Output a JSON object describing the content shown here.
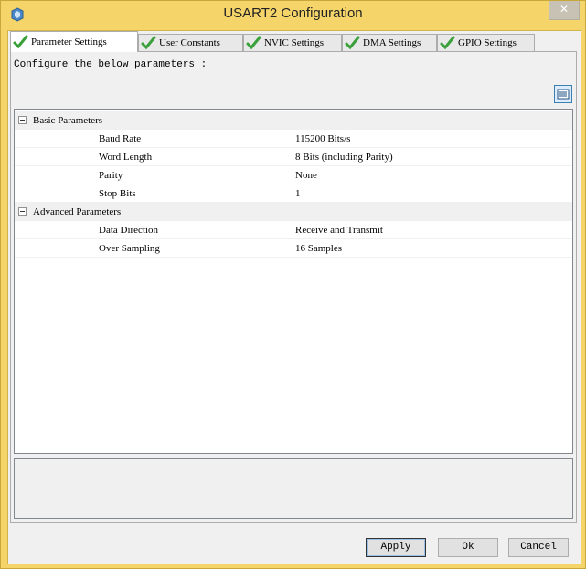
{
  "window": {
    "title": "USART2 Configuration",
    "close_label": "✕"
  },
  "tabs": [
    {
      "label": "Parameter Settings",
      "active": true
    },
    {
      "label": "User Constants",
      "active": false
    },
    {
      "label": "NVIC Settings",
      "active": false
    },
    {
      "label": "DMA Settings",
      "active": false
    },
    {
      "label": "GPIO Settings",
      "active": false
    }
  ],
  "instructions": "Configure the below parameters :",
  "groups": [
    {
      "label": "Basic Parameters",
      "props": [
        {
          "name": "Baud Rate",
          "value": "115200 Bits/s"
        },
        {
          "name": "Word Length",
          "value": "8 Bits (including Parity)"
        },
        {
          "name": "Parity",
          "value": "None"
        },
        {
          "name": "Stop Bits",
          "value": "1"
        }
      ]
    },
    {
      "label": "Advanced Parameters",
      "props": [
        {
          "name": "Data Direction",
          "value": "Receive and Transmit"
        },
        {
          "name": "Over Sampling",
          "value": "16 Samples"
        }
      ]
    }
  ],
  "buttons": {
    "apply": "Apply",
    "ok": "Ok",
    "cancel": "Cancel"
  },
  "colors": {
    "frame": "#f5d56a",
    "check": "#3aa03a"
  }
}
